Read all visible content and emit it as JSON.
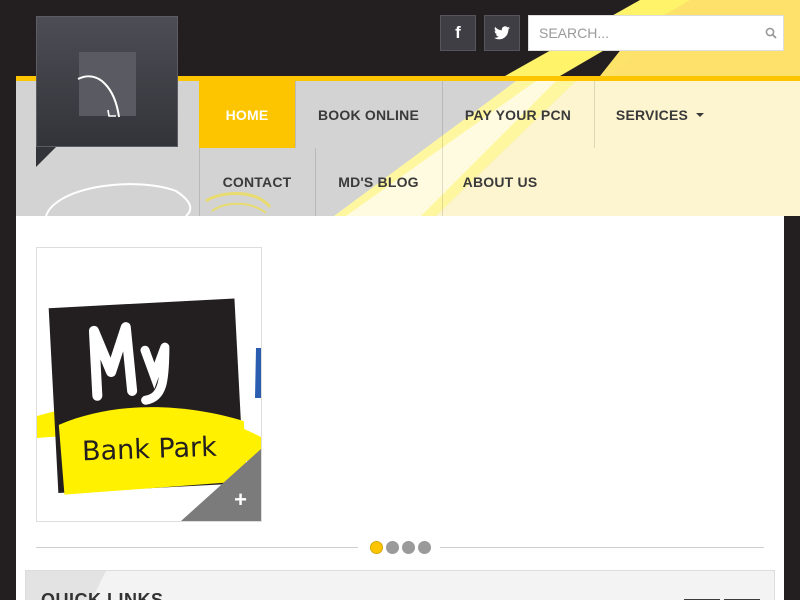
{
  "social": {
    "facebook_glyph": "f",
    "twitter_icon": "twitter-bird-icon"
  },
  "search": {
    "placeholder": "SEARCH..."
  },
  "nav": {
    "items": [
      {
        "label": "HOME",
        "active": true
      },
      {
        "label": "BOOK ONLINE"
      },
      {
        "label": "PAY YOUR PCN"
      },
      {
        "label": "SERVICES"
      },
      {
        "label": "CONTACT"
      },
      {
        "label": "MD'S BLOG"
      },
      {
        "label": "ABOUT US"
      }
    ]
  },
  "gallery": {
    "item": {
      "title_word": "My",
      "subtitle": "Bank Park",
      "plus": "+"
    },
    "pagination": {
      "count": 4,
      "active": 1
    }
  },
  "quick_links": {
    "title": "QUICK LINKS"
  },
  "colors": {
    "accent": "#fcc500",
    "dark": "#231f20",
    "panel": "#d4d4d4"
  }
}
